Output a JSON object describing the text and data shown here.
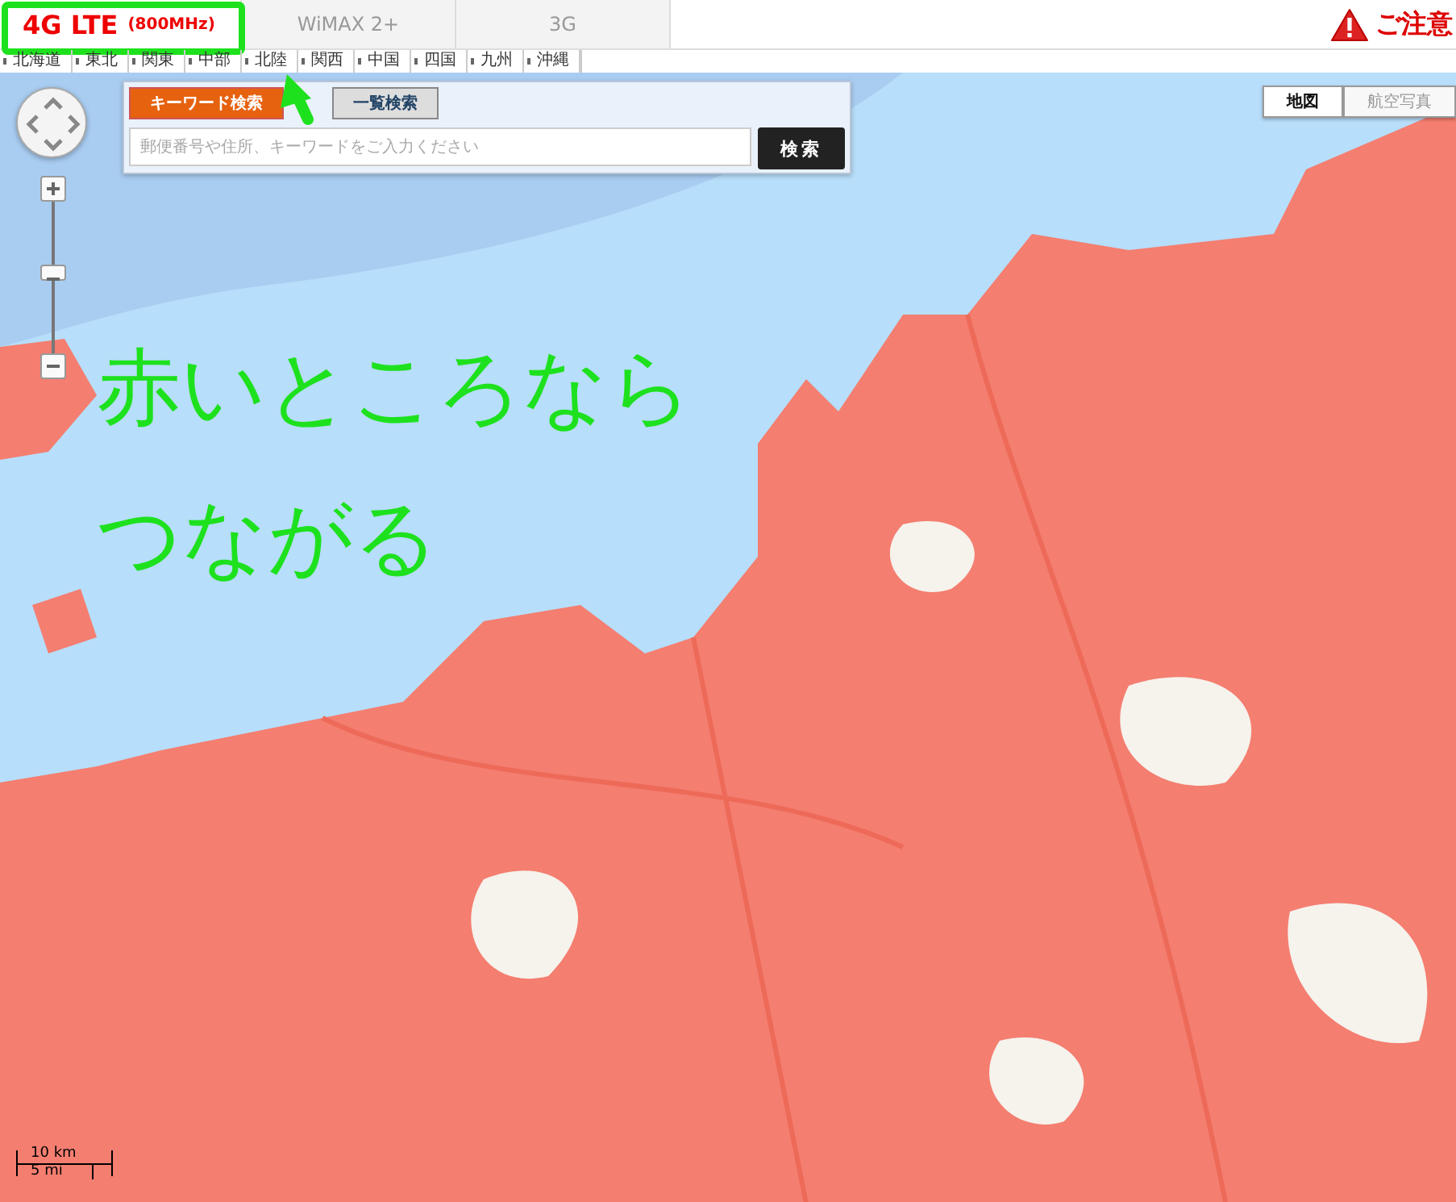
{
  "network_tabs": [
    {
      "label": "4G LTE",
      "sub": "(800MHz)",
      "selected": true
    },
    {
      "label": "WiMAX 2+",
      "selected": false
    },
    {
      "label": "3G",
      "selected": false
    }
  ],
  "notice": {
    "label": "ご注意"
  },
  "regions": [
    "北海道",
    "東北",
    "関東",
    "中部",
    "北陸",
    "関西",
    "中国",
    "四国",
    "九州",
    "沖縄"
  ],
  "search": {
    "tabs": [
      {
        "label": "キーワード検索",
        "selected": true
      },
      {
        "label": "一覧検索",
        "selected": false
      }
    ],
    "placeholder": "郵便番号や住所、キーワードをご入力ください",
    "button": "検索"
  },
  "map_types": [
    {
      "label": "地図",
      "selected": true
    },
    {
      "label": "航空写真",
      "selected": false
    }
  ],
  "scale": {
    "metric": "10 km",
    "imperial": "5 mi"
  },
  "annotation": {
    "lines": [
      "赤いところなら",
      "つながる"
    ]
  }
}
